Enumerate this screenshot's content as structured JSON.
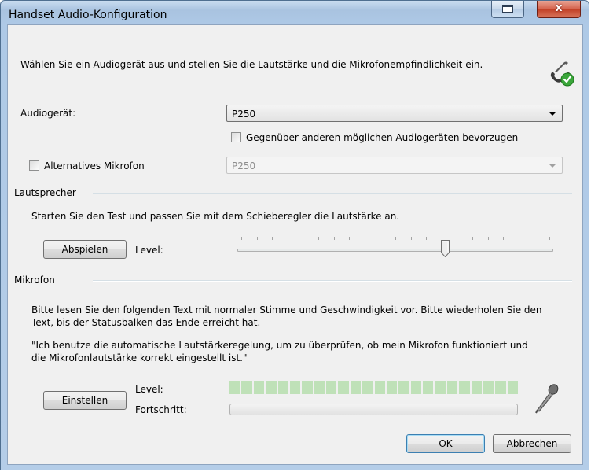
{
  "window": {
    "title": "Handset Audio-Konfiguration",
    "close_glyph": "x"
  },
  "intro_text": "Wählen Sie ein Audiogerät aus und stellen Sie die Lautstärke und die Mikrofonempfindlichkeit ein.",
  "audio_device": {
    "label": "Audiogerät:",
    "value": "P250",
    "prefer_label": "Gegenüber anderen möglichen Audiogeräten bevorzugen",
    "prefer_checked": false
  },
  "alt_mic": {
    "label": "Alternatives Mikrofon",
    "checked": false,
    "value": "P250"
  },
  "speaker": {
    "group_title": "Lautsprecher",
    "instruction": "Starten Sie den Test und passen Sie mit dem Schieberegler die Lautstärke an.",
    "play_button": "Abspielen",
    "level_label": "Level:",
    "slider_value_fraction": 0.66,
    "tick_count": 21
  },
  "microphone": {
    "group_title": "Mikrofon",
    "instruction_line1": "Bitte lesen Sie den folgenden Text mit normaler Stimme und Geschwindigkeit vor. Bitte wiederholen Sie den",
    "instruction_line2": "Text, bis der Statusbalken das Ende erreicht hat.",
    "quote_line1": "\"Ich benutze die automatische Lautstärkeregelung, um zu überprüfen, ob mein Mikrofon funktioniert und",
    "quote_line2": "die Mikrofonlautstärke korrekt eingestellt ist.\"",
    "adjust_button": "Einstellen",
    "level_label": "Level:",
    "progress_label": "Fortschritt:",
    "level_segments": 24,
    "progress_fraction": 0
  },
  "footer": {
    "ok_button": "OK",
    "cancel_button": "Abbrechen"
  },
  "icons": {
    "headset": "handset-check-icon",
    "microphone": "microphone-icon"
  }
}
